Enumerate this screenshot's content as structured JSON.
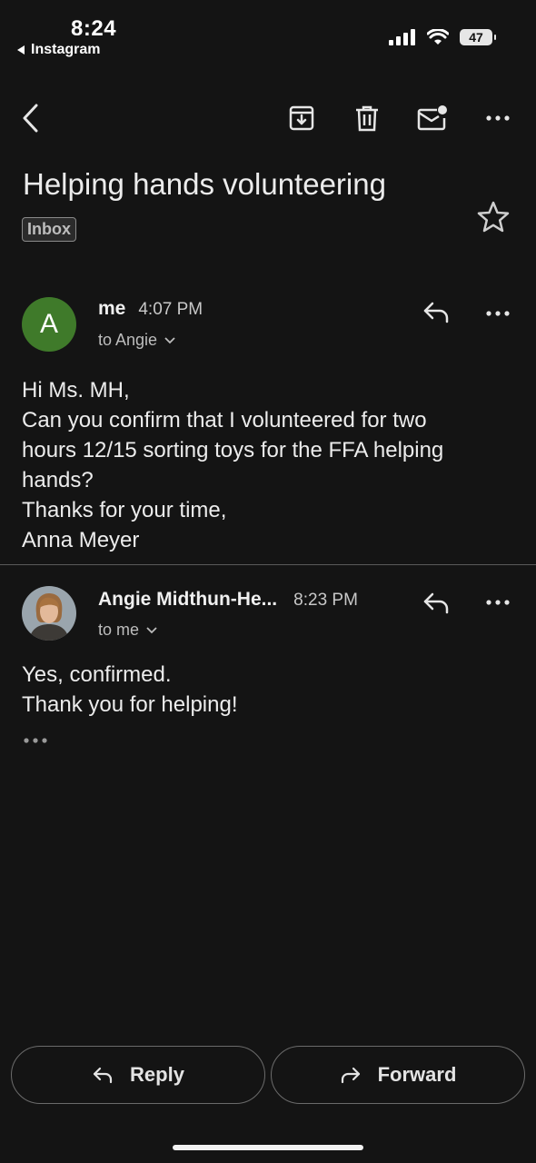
{
  "status_bar": {
    "time": "8:24",
    "back_app": "Instagram",
    "battery": "47"
  },
  "toolbar": {
    "icons": [
      "back-arrow-icon",
      "archive-icon",
      "trash-icon",
      "mark-unread-icon",
      "more-icon"
    ]
  },
  "thread": {
    "subject": "Helping hands volunteering",
    "label": "Inbox"
  },
  "messages": [
    {
      "avatar_letter": "A",
      "avatar_color": "#3f7a2a",
      "sender": "me",
      "time": "4:07 PM",
      "to": "to Angie",
      "body": [
        "Hi Ms. MH,",
        "Can you confirm that I volunteered for two",
        "hours 12/15 sorting toys for the FFA helping",
        "hands?",
        "Thanks for your time,",
        "Anna Meyer"
      ]
    },
    {
      "sender": "Angie Midthun-He...",
      "time": "8:23 PM",
      "to": "to me",
      "body": [
        "Yes, confirmed.",
        "Thank you for helping!"
      ]
    }
  ],
  "actions": {
    "reply_label": "Reply",
    "forward_label": "Forward"
  }
}
